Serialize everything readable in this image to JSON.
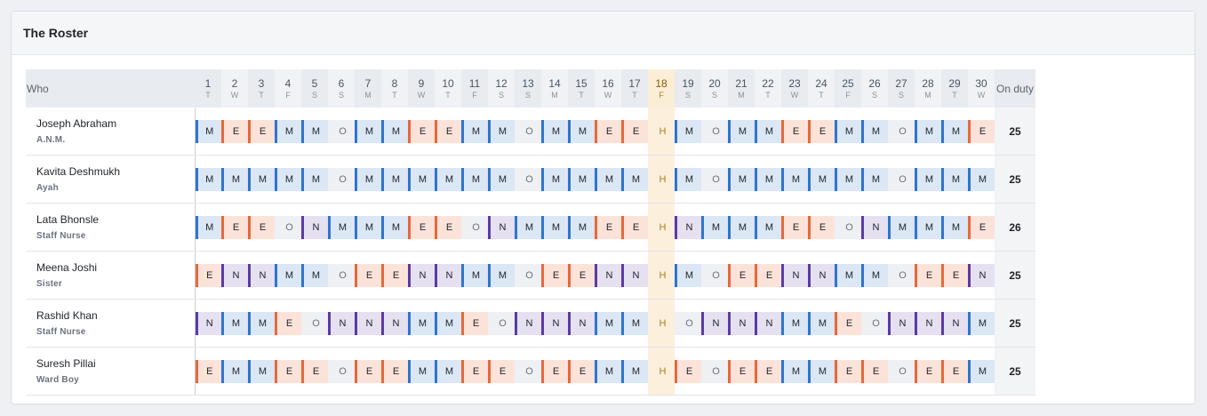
{
  "title": "The Roster",
  "headers": {
    "who": "Who",
    "on_duty": "On duty"
  },
  "holiday_day": 18,
  "days": [
    {
      "n": "1",
      "l": "T"
    },
    {
      "n": "2",
      "l": "W"
    },
    {
      "n": "3",
      "l": "T"
    },
    {
      "n": "4",
      "l": "F"
    },
    {
      "n": "5",
      "l": "S"
    },
    {
      "n": "6",
      "l": "S"
    },
    {
      "n": "7",
      "l": "M"
    },
    {
      "n": "8",
      "l": "T"
    },
    {
      "n": "9",
      "l": "W"
    },
    {
      "n": "10",
      "l": "T"
    },
    {
      "n": "11",
      "l": "F"
    },
    {
      "n": "12",
      "l": "S"
    },
    {
      "n": "13",
      "l": "S"
    },
    {
      "n": "14",
      "l": "M"
    },
    {
      "n": "15",
      "l": "T"
    },
    {
      "n": "16",
      "l": "W"
    },
    {
      "n": "17",
      "l": "T"
    },
    {
      "n": "18",
      "l": "F"
    },
    {
      "n": "19",
      "l": "S"
    },
    {
      "n": "20",
      "l": "S"
    },
    {
      "n": "21",
      "l": "M"
    },
    {
      "n": "22",
      "l": "T"
    },
    {
      "n": "23",
      "l": "W"
    },
    {
      "n": "24",
      "l": "T"
    },
    {
      "n": "25",
      "l": "F"
    },
    {
      "n": "26",
      "l": "S"
    },
    {
      "n": "27",
      "l": "S"
    },
    {
      "n": "28",
      "l": "M"
    },
    {
      "n": "29",
      "l": "T"
    },
    {
      "n": "30",
      "l": "W"
    }
  ],
  "rows": [
    {
      "name": "Joseph Abraham",
      "role": "A.N.M.",
      "duty": "25",
      "shifts": [
        "M",
        "E",
        "E",
        "M",
        "M",
        "O",
        "M",
        "M",
        "E",
        "E",
        "M",
        "M",
        "O",
        "M",
        "M",
        "E",
        "E",
        "H",
        "M",
        "O",
        "M",
        "M",
        "E",
        "E",
        "M",
        "M",
        "O",
        "M",
        "M",
        "E"
      ]
    },
    {
      "name": "Kavita Deshmukh",
      "role": "Ayah",
      "duty": "25",
      "shifts": [
        "M",
        "M",
        "M",
        "M",
        "M",
        "O",
        "M",
        "M",
        "M",
        "M",
        "M",
        "M",
        "O",
        "M",
        "M",
        "M",
        "M",
        "H",
        "M",
        "O",
        "M",
        "M",
        "M",
        "M",
        "M",
        "M",
        "O",
        "M",
        "M",
        "M"
      ]
    },
    {
      "name": "Lata Bhonsle",
      "role": "Staff Nurse",
      "duty": "26",
      "shifts": [
        "M",
        "E",
        "E",
        "O",
        "N",
        "M",
        "M",
        "M",
        "E",
        "E",
        "O",
        "N",
        "M",
        "M",
        "M",
        "E",
        "E",
        "H",
        "N",
        "M",
        "M",
        "M",
        "E",
        "E",
        "O",
        "N",
        "M",
        "M",
        "M",
        "E"
      ]
    },
    {
      "name": "Meena Joshi",
      "role": "Sister",
      "duty": "25",
      "shifts": [
        "E",
        "N",
        "N",
        "M",
        "M",
        "O",
        "E",
        "E",
        "N",
        "N",
        "M",
        "M",
        "O",
        "E",
        "E",
        "N",
        "N",
        "H",
        "M",
        "O",
        "E",
        "E",
        "N",
        "N",
        "M",
        "M",
        "O",
        "E",
        "E",
        "N"
      ]
    },
    {
      "name": "Rashid Khan",
      "role": "Staff Nurse",
      "duty": "25",
      "shifts": [
        "N",
        "M",
        "M",
        "E",
        "O",
        "N",
        "N",
        "N",
        "M",
        "M",
        "E",
        "O",
        "N",
        "N",
        "N",
        "M",
        "M",
        "H",
        "O",
        "N",
        "N",
        "N",
        "M",
        "M",
        "E",
        "O",
        "N",
        "N",
        "N",
        "M"
      ]
    },
    {
      "name": "Suresh Pillai",
      "role": "Ward Boy",
      "duty": "25",
      "shifts": [
        "E",
        "M",
        "M",
        "E",
        "E",
        "O",
        "E",
        "E",
        "M",
        "M",
        "E",
        "E",
        "O",
        "E",
        "E",
        "M",
        "M",
        "H",
        "E",
        "O",
        "E",
        "E",
        "M",
        "M",
        "E",
        "E",
        "O",
        "E",
        "E",
        "M"
      ]
    }
  ],
  "colors": {
    "morning": "#2f74d0",
    "evening": "#e8683a",
    "night": "#5b3aa5",
    "holiday": "#fcefdc"
  }
}
